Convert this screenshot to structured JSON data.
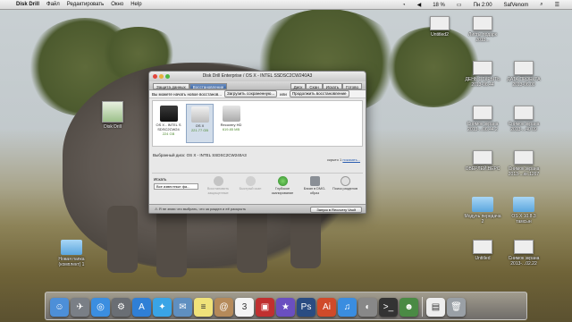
{
  "menubar": {
    "apple": "",
    "app": "Disk Drill",
    "items": [
      "Файл",
      "Редактировать",
      "Окно",
      "Help"
    ],
    "battery": "18 %",
    "clock": "Пн 2:00",
    "user": "SafVenom"
  },
  "window": {
    "title": "Disk Drill Enterprise  /  OS X - INTEL SSDSC2CW240A3",
    "tabs_left": [
      "Защита данных",
      "Восстановление"
    ],
    "tabs_right": [
      "Диск",
      "Скан",
      "Искать",
      "Готово"
    ],
    "msg_prefix": "Вы можете начать новое восстанов...",
    "load_btn": "Загрузить сохраненную...",
    "or_text": "или",
    "continue_btn": "Продолжить восстановление",
    "drives": [
      {
        "name": "OS X - INTEL S SDSC2CW24",
        "size": "224 GB",
        "selected": false
      },
      {
        "name": "OS X",
        "size": "221.77 GB",
        "selected": true
      },
      {
        "name": "Recovery HD",
        "size": "619.85 MB",
        "selected": false
      }
    ],
    "selected_disk": "Выбранный диск: OS X - INTEL SSDSC2CW240A3",
    "hidden": "скрыто 1",
    "show_link": "показать...",
    "search_label": "Искать",
    "select_value": "Все известные фа...",
    "actions": [
      {
        "label": "Восстановить защищенные",
        "dim": true,
        "color": "#b5b5b5"
      },
      {
        "label": "Быстрый скан",
        "dim": true,
        "color": "#c4c4c4"
      },
      {
        "label": "Глубокое сканирование",
        "dim": false,
        "color": "#4aa53a"
      },
      {
        "label": "Бэкап в DMG-образ",
        "dim": false,
        "color": "#8a8f96"
      },
      {
        "label": "Поиск разделов",
        "dim": false,
        "color": "#d9d9d9"
      }
    ],
    "warning": "Я не знаю что выбрать, что за раздел и её раскрыть",
    "recovery_btn": "Запуск в Recovery Vault"
  },
  "desktop": {
    "left_icons": [
      {
        "label": "Disk Drill"
      },
      {
        "label": "Новая папка (комплект) 1"
      }
    ],
    "right_icons": [
      {
        "label": "Untitled2"
      },
      {
        "label": "Листы подарк 2013..."
      },
      {
        "label": "ДЕНЬ ОТКРЫТЬ 2013-06.44"
      },
      {
        "label": "ДАТА ПРОЕКТА 2013-06.00"
      },
      {
        "label": "Снимок экрана 2013-...06.44 2"
      },
      {
        "label": "Снимок экрана 2013-...40 09"
      },
      {
        "label": "ОВЕРЛЕЙ.ВЕРС"
      },
      {
        "label": "Снимок экрана 2013-...кн.1267"
      },
      {
        "label": "Модуль передача 2"
      },
      {
        "label": "OS X 10.8.3 тамсын"
      },
      {
        "label": "Untitled"
      },
      {
        "label": "Снимок экрана 2013-...02.22"
      }
    ]
  },
  "dock": [
    {
      "name": "finder-icon",
      "color": "#4d8fd8",
      "glyph": "☺"
    },
    {
      "name": "launchpad-icon",
      "color": "#7a7f86",
      "glyph": "✈"
    },
    {
      "name": "safari-icon",
      "color": "#3b8ee0",
      "glyph": "◎"
    },
    {
      "name": "system-prefs-icon",
      "color": "#6a6e74",
      "glyph": "⚙"
    },
    {
      "name": "appstore-icon",
      "color": "#2f7fd6",
      "glyph": "A"
    },
    {
      "name": "twitter-icon",
      "color": "#39a4e6",
      "glyph": "✦"
    },
    {
      "name": "mail-icon",
      "color": "#5f8fc0",
      "glyph": "✉"
    },
    {
      "name": "notes-icon",
      "color": "#f0e27a",
      "glyph": "≡"
    },
    {
      "name": "contacts-icon",
      "color": "#b58a5a",
      "glyph": "@"
    },
    {
      "name": "calendar-icon",
      "color": "#f4f4f4",
      "glyph": "3"
    },
    {
      "name": "photobooth-icon",
      "color": "#c03030",
      "glyph": "▣"
    },
    {
      "name": "imovie-icon",
      "color": "#6a4fc0",
      "glyph": "★"
    },
    {
      "name": "photoshop-icon",
      "color": "#2a4c82",
      "glyph": "Ps"
    },
    {
      "name": "illustrator-icon",
      "color": "#d04a2a",
      "glyph": "Ai"
    },
    {
      "name": "itunes-icon",
      "color": "#3a8de0",
      "glyph": "♫"
    },
    {
      "name": "preview-icon",
      "color": "#888",
      "glyph": "◐"
    },
    {
      "name": "terminal-icon",
      "color": "#333",
      "glyph": ">_"
    },
    {
      "name": "diskdrill-icon",
      "color": "#4a8a44",
      "glyph": "☻"
    },
    {
      "name": "document-icon",
      "color": "#eeeeee",
      "glyph": "▤"
    },
    {
      "name": "trash-icon",
      "color": "#9aa0a6",
      "glyph": "🗑"
    }
  ]
}
